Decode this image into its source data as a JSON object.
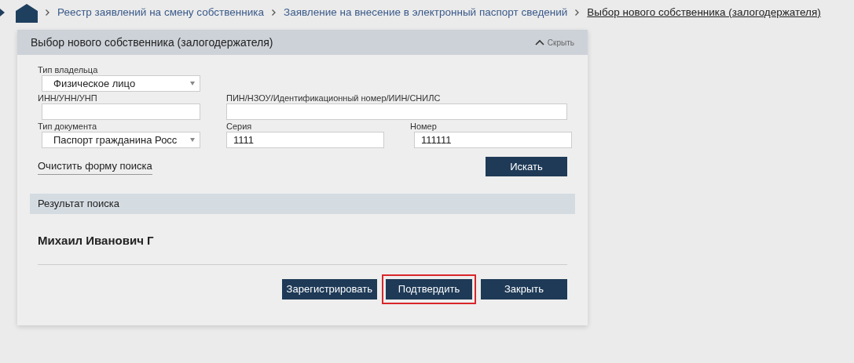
{
  "breadcrumbs": [
    {
      "label": "Реестр заявлений на смену собственника",
      "current": false
    },
    {
      "label": "Заявление на внесение в электронный паспорт сведений",
      "current": false
    },
    {
      "label": "Выбор нового собственника (залогодержателя)",
      "current": true
    }
  ],
  "panel": {
    "title": "Выбор нового собственника (залогодержателя)",
    "collapse": "Скрыть",
    "owner_type": {
      "label": "Тип владельца",
      "value": "Физическое лицо"
    },
    "inn": {
      "label": "ИНН/УНН/УНП"
    },
    "pin": {
      "label": "ПИН/НЗОУ/Идентификационный номер/ИИН/СНИЛС"
    },
    "doc_type": {
      "label": "Тип документа",
      "value": "Паспорт гражданина Росс"
    },
    "series": {
      "label": "Серия",
      "value": "1111"
    },
    "number": {
      "label": "Номер",
      "value": "111111"
    },
    "clear_link": "Очистить форму поиска",
    "search_button": "Искать",
    "result_header": "Результат поиска",
    "result_name": "Михаил Иванович Г",
    "buttons": [
      {
        "label": "Зарегистрировать",
        "highlighted": false
      },
      {
        "label": "Подтвердить",
        "highlighted": true
      },
      {
        "label": "Закрыть",
        "highlighted": false
      }
    ]
  }
}
